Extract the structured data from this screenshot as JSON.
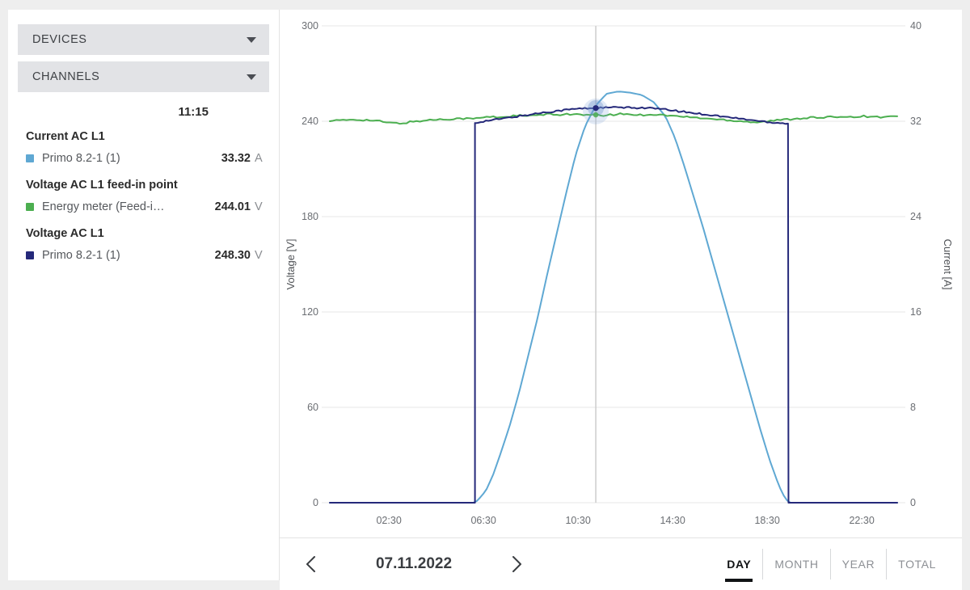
{
  "sidebar": {
    "panels": [
      {
        "label": "DEVICES",
        "icon": "chevron-down-icon"
      },
      {
        "label": "CHANNELS",
        "icon": "chevron-down-icon"
      }
    ],
    "readout": {
      "time": "11:15",
      "groups": [
        {
          "title": "Current AC L1",
          "rows": [
            {
              "name": "Primo 8.2-1 (1)",
              "value": "33.32",
              "unit": "A",
              "color": "#5fa8d3"
            }
          ]
        },
        {
          "title": "Voltage AC L1 feed-in point",
          "rows": [
            {
              "name": "Energy meter (Feed-i…",
              "value": "244.01",
              "unit": "V",
              "color": "#4caf50"
            }
          ]
        },
        {
          "title": "Voltage AC L1",
          "rows": [
            {
              "name": "Primo 8.2-1 (1)",
              "value": "248.30",
              "unit": "V",
              "color": "#25297a"
            }
          ]
        }
      ]
    }
  },
  "bottom": {
    "prev_icon": "chevron-left-icon",
    "next_icon": "chevron-right-icon",
    "date": "07.11.2022",
    "tabs": [
      {
        "label": "DAY",
        "active": true
      },
      {
        "label": "MONTH",
        "active": false
      },
      {
        "label": "YEAR",
        "active": false
      },
      {
        "label": "TOTAL",
        "active": false
      }
    ]
  },
  "chart_data": {
    "type": "line",
    "title": "",
    "xlabel": "",
    "ylabel": "Voltage [V]",
    "y2label": "Current [A]",
    "grid": true,
    "legend": "none",
    "x_ticks": [
      "02:30",
      "06:30",
      "10:30",
      "14:30",
      "18:30",
      "22:30"
    ],
    "x_tick_hours": [
      2.5,
      6.5,
      10.5,
      14.5,
      18.5,
      22.5
    ],
    "xlim": [
      0,
      24
    ],
    "y_ticks": [
      0,
      60,
      120,
      180,
      240,
      300
    ],
    "ylim": [
      0,
      300
    ],
    "y2_ticks": [
      0,
      8,
      16,
      24,
      32,
      40
    ],
    "y2lim": [
      0,
      40
    ],
    "cursor": {
      "time": "11:15",
      "hour": 11.25
    },
    "series": [
      {
        "name": "Voltage AC L1 feed-in point",
        "source": "Energy meter (Feed-in point)",
        "color": "#4caf50",
        "axis": "left",
        "unit": "V",
        "value_at_cursor": 244.01,
        "x": [
          0.0,
          0.5,
          1.0,
          1.5,
          2.0,
          2.5,
          3.0,
          3.3,
          3.6,
          4.0,
          4.4,
          4.8,
          5.2,
          5.6,
          6.0,
          6.4,
          6.8,
          7.2,
          7.6,
          8.0,
          8.4,
          8.8,
          9.2,
          9.6,
          10.0,
          10.4,
          10.8,
          11.25,
          11.6,
          12.0,
          12.4,
          12.8,
          13.2,
          13.6,
          14.0,
          14.4,
          14.8,
          15.2,
          15.6,
          16.0,
          16.4,
          16.8,
          17.2,
          17.6,
          18.0,
          18.4,
          18.8,
          19.2,
          19.6,
          20.0,
          20.4,
          20.8,
          21.2,
          21.6,
          22.0,
          22.4,
          22.8,
          23.2,
          23.6,
          24.0
        ],
        "y": [
          240.6,
          240.4,
          241.1,
          240.8,
          240.2,
          239.0,
          238.6,
          239.3,
          239.9,
          240.4,
          241.0,
          241.2,
          241.6,
          241.8,
          241.5,
          242.2,
          242.8,
          242.5,
          243.1,
          243.6,
          243.2,
          243.8,
          244.4,
          244.0,
          244.6,
          244.2,
          243.8,
          244.0,
          243.6,
          244.2,
          244.6,
          244.2,
          243.9,
          244.4,
          244.0,
          243.5,
          243.0,
          242.6,
          242.1,
          241.6,
          241.2,
          240.8,
          240.3,
          239.9,
          239.4,
          239.8,
          240.4,
          241.0,
          241.5,
          242.0,
          242.4,
          242.0,
          242.6,
          243.1,
          242.7,
          243.2,
          243.0,
          242.6,
          242.9,
          242.7
        ]
      },
      {
        "name": "Voltage AC L1",
        "source": "Primo 8.2-1 (1)",
        "color": "#25297a",
        "axis": "left",
        "unit": "V",
        "value_at_cursor": 248.3,
        "note": "inverter AC voltage: zero outside generation window (approx 06:15 - 19:25)",
        "x": [
          0.0,
          6.14,
          6.16,
          6.4,
          6.8,
          7.2,
          7.6,
          8.0,
          8.4,
          8.8,
          9.2,
          9.6,
          10.0,
          10.4,
          10.8,
          11.25,
          11.6,
          12.0,
          12.4,
          12.8,
          13.2,
          13.6,
          14.0,
          14.4,
          14.8,
          15.2,
          15.6,
          16.0,
          16.4,
          16.8,
          17.2,
          17.6,
          18.0,
          18.4,
          18.8,
          19.2,
          19.38,
          19.4,
          24.0
        ],
        "y": [
          0,
          0,
          238.9,
          239.8,
          240.6,
          241.4,
          242.3,
          243.2,
          244.0,
          245.0,
          245.8,
          246.5,
          247.2,
          247.8,
          248.1,
          248.3,
          248.5,
          248.7,
          248.6,
          248.4,
          248.5,
          248.2,
          247.6,
          247.0,
          246.2,
          245.5,
          244.8,
          244.1,
          243.4,
          242.6,
          241.9,
          241.2,
          240.4,
          239.8,
          239.2,
          238.8,
          238.6,
          0,
          0
        ]
      },
      {
        "name": "Current AC L1",
        "source": "Primo 8.2-1 (1)",
        "color": "#5fa8d3",
        "axis": "right",
        "unit": "A",
        "value_at_cursor": 33.32,
        "note": "PV current bell curve peaking near midday",
        "x": [
          0.0,
          6.14,
          6.3,
          6.6,
          6.9,
          7.2,
          7.6,
          8.0,
          8.4,
          8.8,
          9.2,
          9.6,
          10.0,
          10.4,
          10.8,
          11.25,
          11.7,
          12.2,
          12.7,
          13.2,
          13.7,
          14.2,
          14.6,
          15.0,
          15.4,
          15.8,
          16.2,
          16.6,
          17.0,
          17.4,
          17.8,
          18.2,
          18.6,
          19.0,
          19.25,
          19.38,
          19.4,
          24.0
        ],
        "y": [
          0,
          0,
          0.3,
          1.0,
          2.3,
          4.0,
          6.4,
          9.2,
          12.4,
          15.6,
          19.2,
          22.6,
          26.0,
          29.2,
          31.6,
          33.32,
          34.3,
          34.5,
          34.4,
          34.2,
          33.6,
          32.4,
          30.6,
          28.2,
          25.6,
          23.0,
          20.2,
          17.4,
          14.6,
          11.8,
          9.0,
          6.2,
          3.6,
          1.4,
          0.4,
          0.1,
          0,
          0
        ]
      }
    ]
  }
}
